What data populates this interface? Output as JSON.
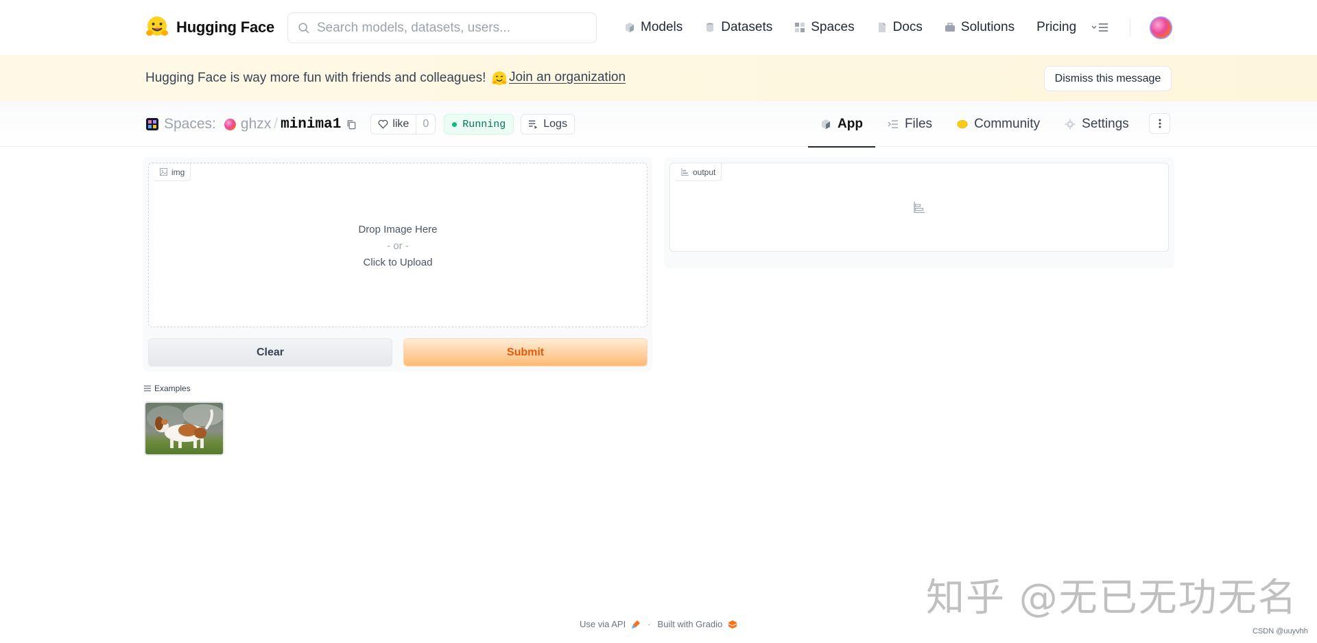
{
  "nav": {
    "logo_text": "Hugging Face",
    "search_placeholder": "Search models, datasets, users...",
    "links": [
      {
        "label": "Models",
        "icon": "cube-icon"
      },
      {
        "label": "Datasets",
        "icon": "database-icon"
      },
      {
        "label": "Spaces",
        "icon": "grid-icon"
      },
      {
        "label": "Docs",
        "icon": "doc-icon"
      },
      {
        "label": "Solutions",
        "icon": "briefcase-icon"
      },
      {
        "label": "Pricing",
        "icon": ""
      }
    ]
  },
  "banner": {
    "message": "Hugging Face is way more fun with friends and colleagues!",
    "link": "Join an organization",
    "dismiss": "Dismiss this message"
  },
  "space": {
    "section": "Spaces:",
    "owner": "ghzx",
    "repo": "minima1",
    "like_label": "like",
    "like_count": "0",
    "status": "Running",
    "logs_label": "Logs",
    "tabs": [
      {
        "label": "App",
        "active": true
      },
      {
        "label": "Files",
        "active": false
      },
      {
        "label": "Community",
        "active": false
      },
      {
        "label": "Settings",
        "active": false
      }
    ]
  },
  "app": {
    "input_label": "img",
    "drop_text": "Drop Image Here",
    "or_text": "- or -",
    "upload_text": "Click to Upload",
    "clear_label": "Clear",
    "submit_label": "Submit",
    "output_label": "output",
    "examples_label": "Examples"
  },
  "footer": {
    "api_text": "Use via API",
    "built_text": "Built with Gradio"
  },
  "watermark": {
    "text": "知乎 @无已无功无名",
    "small": "CSDN @uuyvhh"
  },
  "colors": {
    "accent_orange": "#ea580c",
    "running_green": "#047857",
    "banner_bg": "#fef9e7"
  }
}
